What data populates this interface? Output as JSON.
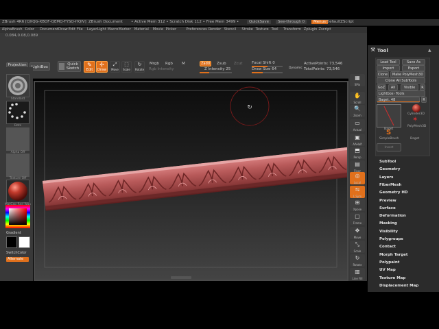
{
  "titlebar": {
    "app": "ZBrush 4R6 [QXQG-XBOF-QEMQ-TYSQ-HQIV]",
    "doc": "ZBrush Document",
    "mem": "• Active Mem 312 • Scratch Disk 112 • Free Mem 3499 •",
    "quicksave": "QuickSave",
    "seethrough": "See-through  0",
    "menus": "Menus",
    "script": "DefaultZScript",
    "stats": "0.084,0.08,0.089"
  },
  "menubar": [
    "Alpha",
    "Brush",
    "Color",
    "Document",
    "Draw",
    "Edit",
    "File",
    "Layer",
    "Light",
    "Macro",
    "Marker",
    "Material",
    "Movie",
    "Picker",
    "Preferences",
    "Render",
    "Stencil",
    "Stroke",
    "Texture",
    "Tool",
    "Transform",
    "Zplugin",
    "Zscript"
  ],
  "shelf": {
    "projection_master": "Projection Master",
    "lightbox": "LightBox",
    "quick_sketch": "Quick Sketch",
    "edit": "Edit",
    "draw": "Draw",
    "move": "Move",
    "scale": "Scale",
    "rotate": "Rotate",
    "mrgb": "Mrgb",
    "rgb": "Rgb",
    "m": "M",
    "zadd": "Zadd",
    "zsub": "Zsub",
    "zcut": "Zcut",
    "rgb_intensity": "Rgb Intensity",
    "z_intensity": "Z Intensity 25",
    "focal_shift": "Focal Shift 0",
    "draw_size": "Draw Size 64",
    "dynamic": "Dynamic",
    "active_points": "ActivePoints: 73,546",
    "total_points": "TotalPoints: 73,546"
  },
  "lefttray": {
    "standard": "Standard",
    "dots": "Dots",
    "alpha_off": "Alpha Off",
    "texture_off": "Texture Off",
    "material": "MatCap Red Wax",
    "gradient": "Gradient",
    "switchcolor": "SwitchColor",
    "alternate": "Alternate"
  },
  "righttools": [
    "SPix",
    "Scroll",
    "Zoom",
    "Actual",
    "AAHalf",
    "Persp",
    "Floor",
    "Local",
    "L.Sym",
    "Xpose",
    "Frame",
    "Move",
    "Scale",
    "Rotate",
    "Line Fill"
  ],
  "palette": {
    "title": "Tool",
    "load_tool": "Load Tool",
    "save_as": "Save As",
    "import": "Import",
    "export": "Export",
    "clone": "Clone",
    "make_polymesh": "Make PolyMesh3D",
    "clone_all": "Clone All SubTools",
    "goz": "GoZ",
    "all": "All",
    "visible": "Visible",
    "r": "R",
    "lightbox_tools": "Lightbox› Tools",
    "baget": "Baget. 48",
    "tool_names": [
      "Baget",
      "Cylinder3D",
      "PolyMesh3D",
      "SimpleBrush",
      "Baget"
    ],
    "insert": "Insert",
    "menu": [
      "SubTool",
      "Geometry",
      "Layers",
      "FiberMesh",
      "Geometry HD",
      "Preview",
      "Surface",
      "Deformation",
      "Masking",
      "Visibility",
      "Polygroups",
      "Contact",
      "Morph Target",
      "Polypaint",
      "UV Map",
      "Texture Map",
      "Displacement Map"
    ]
  },
  "colors": {
    "accent": "#e0701c",
    "molding": "#b85a5a"
  }
}
